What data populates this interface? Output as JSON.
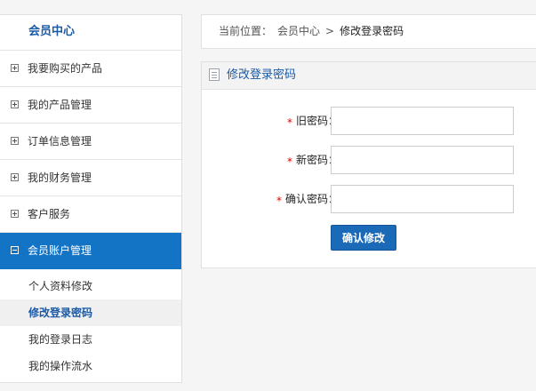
{
  "sidebar": {
    "title": "会员中心",
    "items": [
      {
        "label": "我要购买的产品"
      },
      {
        "label": "我的产品管理"
      },
      {
        "label": "订单信息管理"
      },
      {
        "label": "我的财务管理"
      },
      {
        "label": "客户服务"
      }
    ],
    "active": {
      "label": "会员账户管理"
    },
    "subitems": [
      {
        "label": "个人资料修改"
      },
      {
        "label": "修改登录密码"
      },
      {
        "label": "我的登录日志"
      },
      {
        "label": "我的操作流水"
      }
    ]
  },
  "breadcrumb": {
    "prefix": "当前位置：",
    "link": "会员中心",
    "separator": ">",
    "current": "修改登录密码"
  },
  "panel": {
    "title": "修改登录密码",
    "required_mark": "*",
    "fields": [
      {
        "label": "旧密码：",
        "value": "",
        "placeholder": ""
      },
      {
        "label": "新密码：",
        "value": "",
        "placeholder": ""
      },
      {
        "label": "确认密码：",
        "value": "",
        "placeholder": ""
      }
    ],
    "submit_label": "确认修改"
  },
  "colors": {
    "accent": "#1374c6",
    "link_text": "#1a5aa6",
    "required": "#dd0000"
  }
}
